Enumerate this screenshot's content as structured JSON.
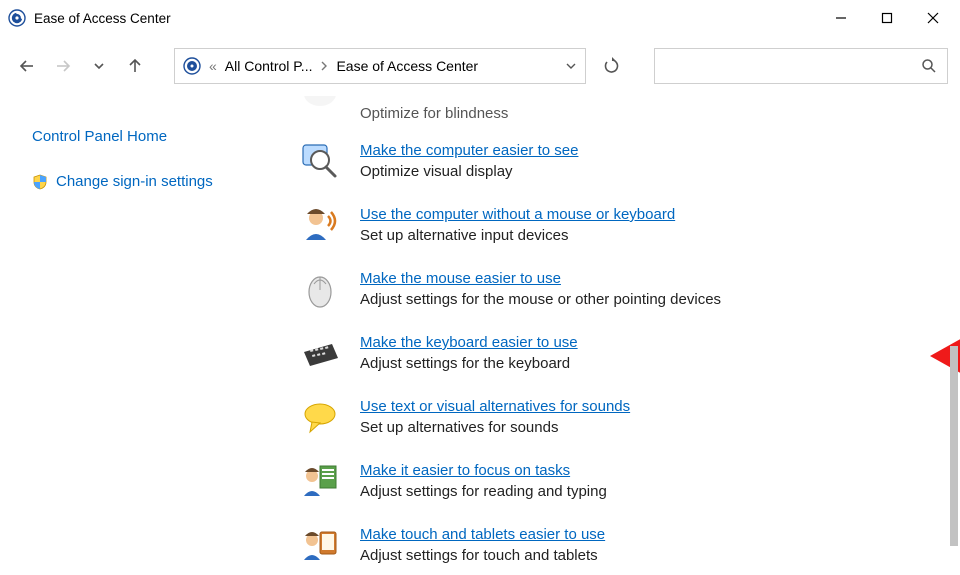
{
  "window": {
    "title": "Ease of Access Center"
  },
  "breadcrumb": {
    "root_glyph": "«",
    "level1": "All Control P...",
    "level2": "Ease of Access Center"
  },
  "search": {
    "placeholder": ""
  },
  "sidebar": {
    "items": [
      {
        "label": "Control Panel Home",
        "has_shield": false
      },
      {
        "label": "Change sign-in settings",
        "has_shield": true
      }
    ]
  },
  "main": {
    "cut_item_desc": "Optimize for blindness",
    "items": [
      {
        "link": "Make the computer easier to see",
        "desc": "Optimize visual display"
      },
      {
        "link": "Use the computer without a mouse or keyboard",
        "desc": "Set up alternative input devices"
      },
      {
        "link": "Make the mouse easier to use",
        "desc": "Adjust settings for the mouse or other pointing devices"
      },
      {
        "link": "Make the keyboard easier to use",
        "desc": "Adjust settings for the keyboard"
      },
      {
        "link": "Use text or visual alternatives for sounds",
        "desc": "Set up alternatives for sounds"
      },
      {
        "link": "Make it easier to focus on tasks",
        "desc": "Adjust settings for reading and typing"
      },
      {
        "link": "Make touch and tablets easier to use",
        "desc": "Adjust settings for touch and tablets"
      }
    ]
  }
}
